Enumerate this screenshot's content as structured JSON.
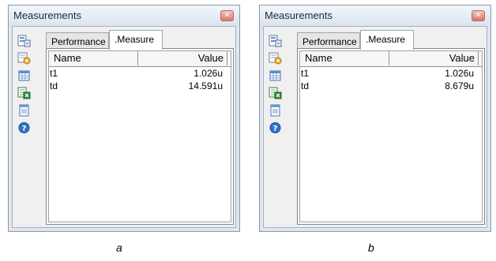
{
  "panels": [
    {
      "title": "Measurements",
      "tabs": [
        {
          "label": "Performance"
        },
        {
          "label": ".Measure"
        }
      ],
      "columns": {
        "name": "Name",
        "value": "Value"
      },
      "rows": [
        {
          "name": "t1",
          "value": "1.026u"
        },
        {
          "name": "td",
          "value": "14.591u"
        }
      ],
      "caption": "a"
    },
    {
      "title": "Measurements",
      "tabs": [
        {
          "label": "Performance"
        },
        {
          "label": ".Measure"
        }
      ],
      "columns": {
        "name": "Name",
        "value": "Value"
      },
      "rows": [
        {
          "name": "t1",
          "value": "1.026u"
        },
        {
          "name": "td",
          "value": "8.679u"
        }
      ],
      "caption": "b"
    }
  ],
  "toolbar_icons": [
    "table-export-icon",
    "settings-icon",
    "grid-icon",
    "excel-export-icon",
    "document-icon",
    "help-icon"
  ],
  "colors": {
    "close": "#d7776b",
    "help": "#2e74c9"
  }
}
